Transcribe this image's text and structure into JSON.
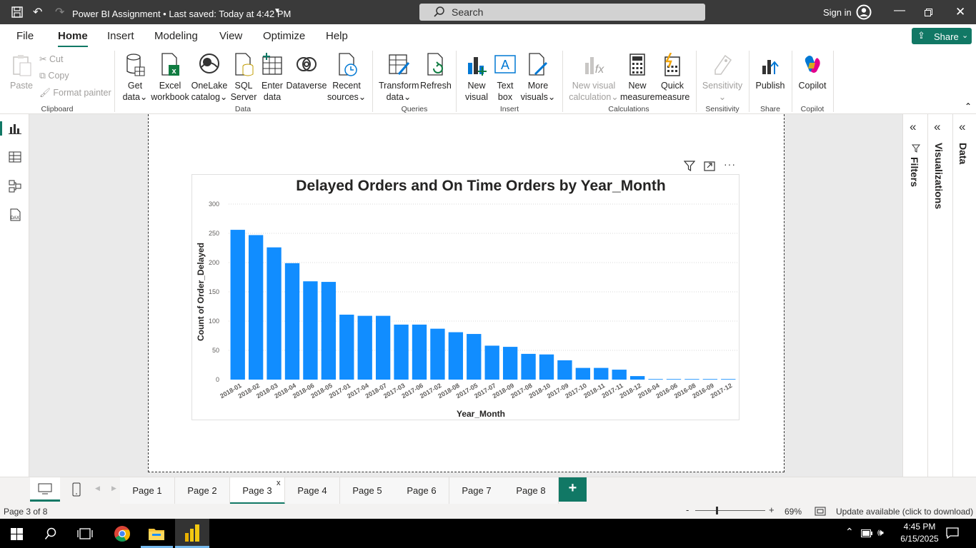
{
  "titlebar": {
    "title": "Power BI Assignment • Last saved: Today at 4:42 PM",
    "search_placeholder": "Search",
    "sign_in": "Sign in"
  },
  "menu": {
    "items": [
      "File",
      "Home",
      "Insert",
      "Modeling",
      "View",
      "Optimize",
      "Help"
    ],
    "active": "Home",
    "share_label": "Share"
  },
  "ribbon": {
    "clipboard": {
      "paste": "Paste",
      "cut": "Cut",
      "copy": "Copy",
      "format_painter": "Format painter",
      "group": "Clipboard"
    },
    "data": {
      "get_data": [
        "Get",
        "data"
      ],
      "excel": [
        "Excel",
        "workbook"
      ],
      "onelake": [
        "OneLake",
        "catalog"
      ],
      "sql": [
        "SQL",
        "Server"
      ],
      "enter_data": [
        "Enter",
        "data"
      ],
      "dataverse": [
        "Dataverse",
        ""
      ],
      "recent": [
        "Recent",
        "sources"
      ],
      "group": "Data"
    },
    "queries": {
      "transform": [
        "Transform",
        "data"
      ],
      "refresh": [
        "Refresh",
        ""
      ],
      "group": "Queries"
    },
    "insert": {
      "new_visual": [
        "New",
        "visual"
      ],
      "text_box": [
        "Text",
        "box"
      ],
      "more_visuals": [
        "More",
        "visuals"
      ],
      "group": "Insert"
    },
    "calculations": {
      "new_visual_calc": [
        "New visual",
        "calculation"
      ],
      "new_measure": [
        "New",
        "measure"
      ],
      "quick_measure": [
        "Quick",
        "measure"
      ],
      "group": "Calculations"
    },
    "sensitivity": {
      "label": "Sensitivity",
      "group": "Sensitivity"
    },
    "share": {
      "publish": "Publish",
      "group": "Share"
    },
    "copilot": {
      "label": "Copilot",
      "group": "Copilot"
    }
  },
  "panes": {
    "filters": "Filters",
    "visualizations": "Visualizations",
    "data": "Data"
  },
  "chart_data": {
    "type": "bar",
    "title": "Delayed Orders and On Time Orders by Year_Month",
    "xlabel": "Year_Month",
    "ylabel": "Count of Order_Delayed",
    "ylim": [
      0,
      300
    ],
    "yticks": [
      0,
      50,
      100,
      150,
      200,
      250,
      300
    ],
    "grid": true,
    "bar_color": "#118dff",
    "categories": [
      "2018-01",
      "2018-02",
      "2018-03",
      "2018-04",
      "2018-06",
      "2018-05",
      "2017-01",
      "2017-04",
      "2018-07",
      "2017-03",
      "2017-06",
      "2017-02",
      "2018-08",
      "2017-05",
      "2017-07",
      "2018-09",
      "2017-08",
      "2018-10",
      "2017-09",
      "2017-10",
      "2018-11",
      "2017-11",
      "2018-12",
      "2016-04",
      "2016-06",
      "2016-08",
      "2016-09",
      "2017-12"
    ],
    "values": [
      256,
      247,
      226,
      199,
      168,
      167,
      111,
      109,
      109,
      94,
      94,
      87,
      81,
      78,
      58,
      56,
      44,
      43,
      33,
      20,
      20,
      17,
      6,
      1,
      1,
      1,
      1,
      1
    ]
  },
  "pages": {
    "tabs": [
      "Page 1",
      "Page 2",
      "Page 3",
      "Page 4",
      "Page 5",
      "Page 6",
      "Page 7",
      "Page 8"
    ],
    "active": "Page 3",
    "add": "+"
  },
  "status": {
    "page_info": "Page 3 of 8",
    "zoom": "69%",
    "update": "Update available (click to download)"
  },
  "taskbar": {
    "time": "4:45 PM",
    "date": "6/15/2025"
  }
}
